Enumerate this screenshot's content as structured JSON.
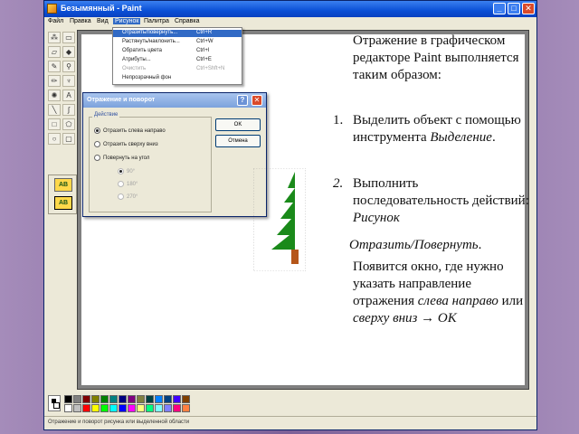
{
  "window": {
    "title": "Безымянный - Paint",
    "controls": [
      "_",
      "□",
      "✕"
    ]
  },
  "menubar": {
    "items": [
      "Файл",
      "Правка",
      "Вид",
      "Рисунок",
      "Палитра",
      "Справка"
    ],
    "active_index": 3
  },
  "image_menu": {
    "items": [
      {
        "label": "Отразить/повернуть...",
        "shortcut": "Ctrl+R",
        "state": "highlighted"
      },
      {
        "label": "Растянуть/наклонить...",
        "shortcut": "Ctrl+W",
        "state": "normal"
      },
      {
        "label": "Обратить цвета",
        "shortcut": "Ctrl+I",
        "state": "normal"
      },
      {
        "label": "Атрибуты...",
        "shortcut": "Ctrl+E",
        "state": "normal"
      },
      {
        "label": "Очистить",
        "shortcut": "Ctrl+Shft+N",
        "state": "disabled"
      },
      {
        "label": "Непрозрачный фон",
        "shortcut": "",
        "state": "normal"
      }
    ]
  },
  "dialog": {
    "title": "Отражение и поворот",
    "help_label": "?",
    "close_label": "✕",
    "group_label": "Действие",
    "options": [
      {
        "label": "Отразить слева направо",
        "checked": true
      },
      {
        "label": "Отразить сверху вниз",
        "checked": false
      },
      {
        "label": "Повернуть на угол",
        "checked": false
      }
    ],
    "angles": [
      {
        "label": "90°",
        "checked": true
      },
      {
        "label": "180°",
        "checked": false
      },
      {
        "label": "270°",
        "checked": false
      }
    ],
    "ok_label": "OK",
    "cancel_label": "Отмена"
  },
  "status_text": "Отражение и поворот рисунка или выделенной области",
  "palette": {
    "colors_row1": [
      "#000000",
      "#808080",
      "#800000",
      "#808000",
      "#008000",
      "#008080",
      "#000080",
      "#800080",
      "#808040",
      "#004040",
      "#0080ff",
      "#004080",
      "#4000ff",
      "#804000"
    ],
    "colors_row2": [
      "#ffffff",
      "#c0c0c0",
      "#ff0000",
      "#ffff00",
      "#00ff00",
      "#00ffff",
      "#0000ff",
      "#ff00ff",
      "#ffff80",
      "#00ff80",
      "#80ffff",
      "#8080ff",
      "#ff0080",
      "#ff8040"
    ]
  },
  "tree_colors": {
    "foliage": "#1a8a1a",
    "trunk": "#b5561a"
  },
  "slide": {
    "intro": "Отражение в графическом редакторе Paint выполняется таким образом:",
    "step1_num": "1.",
    "step1_text": "Выделить объект с помощью инструмента",
    "step1_tool": "Выделение",
    "step1_end": ".",
    "step2_num": "2.",
    "step2_text": "Выполнить последовательность действий:",
    "step2_path1": "Рисунок",
    "step2_path2": "Отразить/Повернуть",
    "step2_end": ".",
    "step3_text": "Появится окно, где нужно указать направление отражения",
    "step3_opt1": "слева направо",
    "step3_or": "или",
    "step3_opt2": "сверху вниз",
    "step3_arrow": "→",
    "step3_ok": "OK"
  },
  "accent_colors": {
    "titlebar": "#0b50d6",
    "menu_highlight": "#316ac5",
    "dialog_title": "#7ca2dc"
  }
}
